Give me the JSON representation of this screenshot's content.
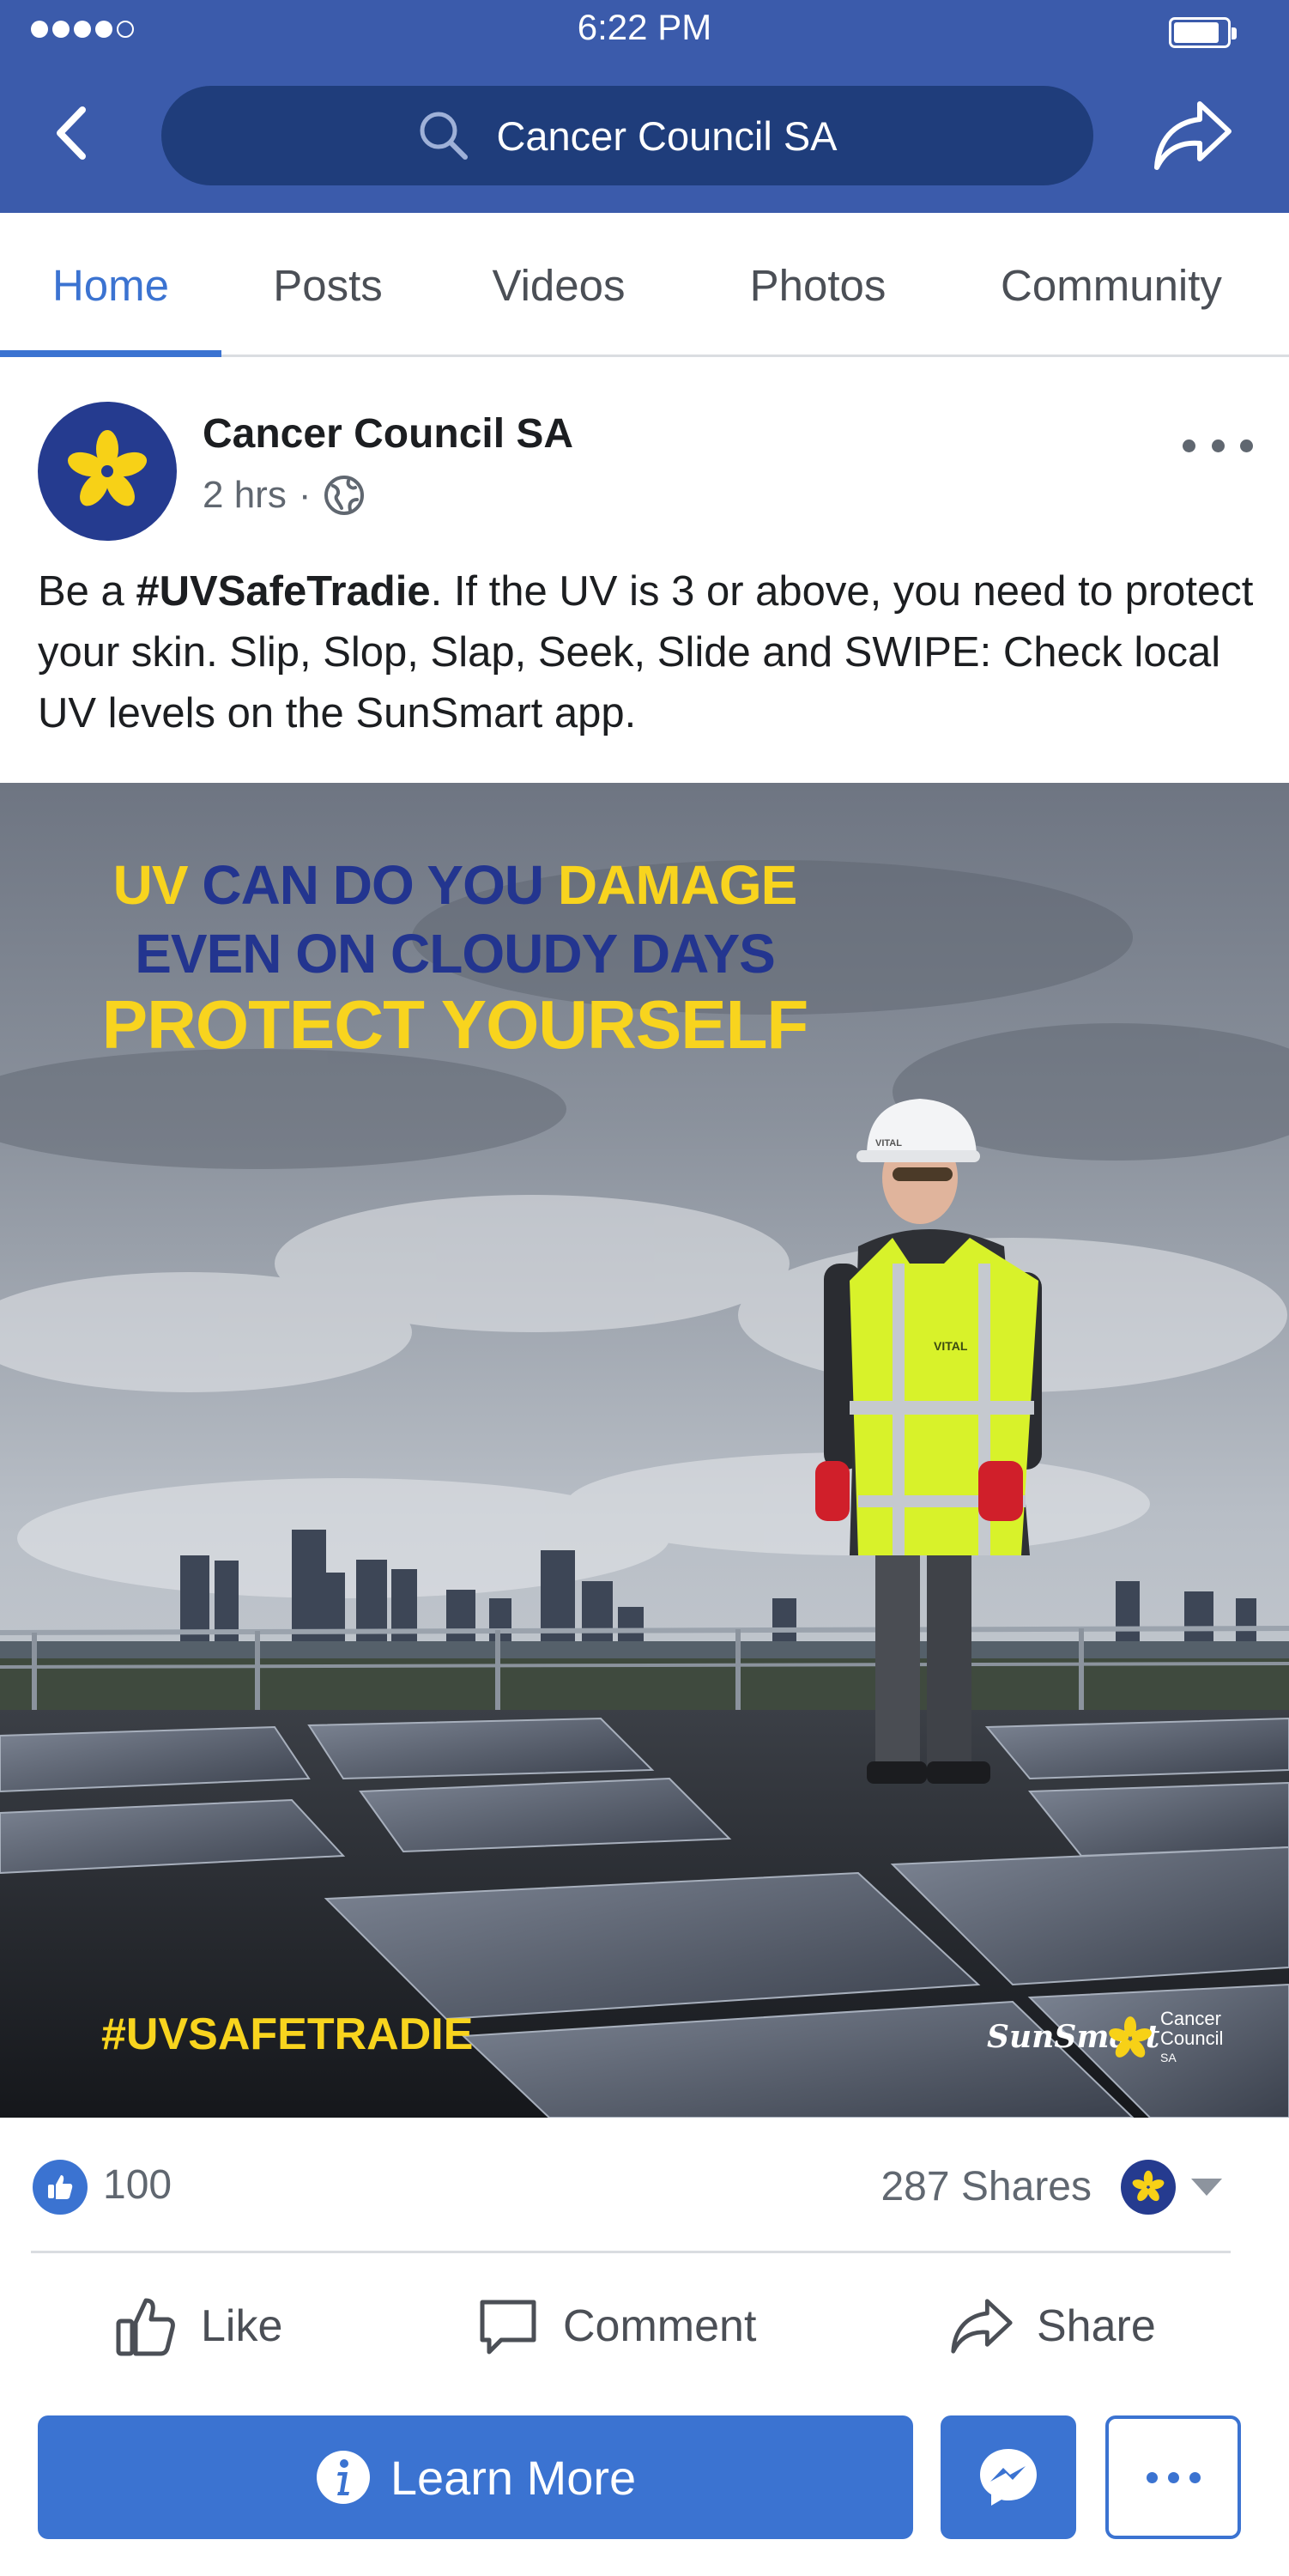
{
  "status_bar": {
    "time": "6:22 PM"
  },
  "header": {
    "search_text": "Cancer Council SA",
    "icons": [
      "back-chevron-icon",
      "search-icon",
      "share-arrow-icon"
    ]
  },
  "tabs": [
    {
      "label": "Home",
      "active": true
    },
    {
      "label": "Posts",
      "active": false
    },
    {
      "label": "Videos",
      "active": false
    },
    {
      "label": "Photos",
      "active": false
    },
    {
      "label": "Community",
      "active": false
    }
  ],
  "post": {
    "page_name": "Cancer Council SA",
    "time": "2 hrs",
    "separator": "·",
    "audience_icon": "globe-icon",
    "text": {
      "prefix": "Be a ",
      "hashtag": "#UVSafeTradie",
      "body": ". If the UV is 3 or above, you need to protect your skin. Slip, Slop, Slap, Seek, Slide and SWIPE: Check local UV levels on the SunSmart app."
    },
    "image": {
      "headline": {
        "line1_a": "UV",
        "line1_b": "CAN DO YOU",
        "line1_c": "DAMAGE",
        "line2": "EVEN ON CLOUDY DAYS",
        "line3": "PROTECT YOURSELF"
      },
      "hashtag": "#UVSAFETRADIE",
      "sunsmart_logo": "SunSmart",
      "cc_logo": {
        "line1": "Cancer",
        "line2": "Council",
        "line3": "SA"
      },
      "helmet_text": "VITAL",
      "vest_text": "VITAL",
      "colors": {
        "yellow": "#f8d41e",
        "navy": "#23358f"
      }
    }
  },
  "reactions": {
    "like_count": "100",
    "shares": "287 Shares"
  },
  "actions": {
    "like": "Like",
    "comment": "Comment",
    "share": "Share"
  },
  "cta": {
    "learn_more": "Learn More"
  },
  "colors": {
    "header_blue": "#3b5bab",
    "search_bg": "#1f3d7b",
    "accent": "#3b73d1",
    "avatar_bg": "#253b8f",
    "daffodil": "#f7d117"
  }
}
